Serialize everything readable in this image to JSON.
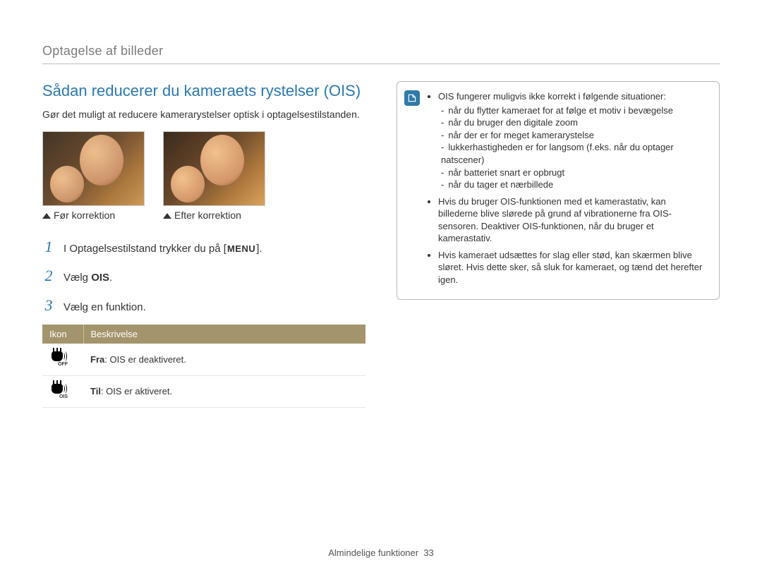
{
  "header": {
    "breadcrumb": "Optagelse af billeder"
  },
  "section": {
    "title": "Sådan reducerer du kameraets rystelser (OIS)",
    "intro": "Gør det muligt at reducere kamerarystelser optisk i optagelsestilstanden."
  },
  "photos": {
    "before_caption": "Før korrektion",
    "after_caption": "Efter korrektion"
  },
  "steps": {
    "n1": "1",
    "t1_part1": "I Optagelsestilstand trykker du på [",
    "t1_menu": "MENU",
    "t1_part2": "].",
    "n2": "2",
    "t2_prefix": "Vælg ",
    "t2_bold": "OIS",
    "t2_suffix": ".",
    "n3": "3",
    "t3": "Vælg en funktion."
  },
  "table": {
    "col1": "Ikon",
    "col2": "Beskrivelse",
    "rows": [
      {
        "sub": "OFF",
        "label": "Fra",
        "desc": ": OIS er deaktiveret."
      },
      {
        "sub": "OIS",
        "label": "Til",
        "desc": ": OIS er aktiveret."
      }
    ]
  },
  "tip": {
    "b1": "OIS fungerer muligvis ikke korrekt i følgende situationer:",
    "s1": "når du flytter kameraet for at følge et motiv i bevægelse",
    "s2": "når du bruger den digitale zoom",
    "s3": "når der er for meget kamerarystelse",
    "s4": "lukkerhastigheden er for langsom (f.eks. når du optager natscener)",
    "s5": "når batteriet snart er opbrugt",
    "s6": "når du tager et nærbillede",
    "b2": "Hvis du bruger OIS-funktionen med et kamerastativ, kan billederne blive slørede på grund af vibrationerne fra OIS-sensoren. Deaktiver OIS-funktionen, når du bruger et kamerastativ.",
    "b3": "Hvis kameraet udsættes for slag eller stød, kan skærmen blive sløret. Hvis dette sker, så sluk for kameraet, og tænd det herefter igen."
  },
  "footer": {
    "section": "Almindelige funktioner",
    "page": "33"
  }
}
